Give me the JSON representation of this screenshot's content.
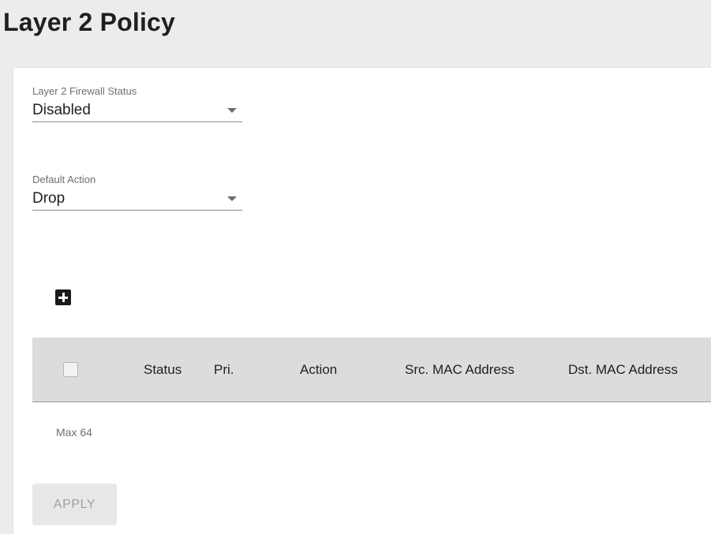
{
  "page": {
    "title": "Layer 2 Policy"
  },
  "firewall_status": {
    "label": "Layer 2 Firewall Status",
    "value": "Disabled"
  },
  "default_action": {
    "label": "Default Action",
    "value": "Drop"
  },
  "toolbar": {
    "add_icon": "plus-box-icon"
  },
  "table": {
    "columns": [
      "Status",
      "Pri.",
      "Action",
      "Src. MAC Address",
      "Dst. MAC Address"
    ],
    "rows": [],
    "max_label": "Max 64"
  },
  "actions": {
    "apply_label": "APPLY"
  },
  "colors": {
    "page_background": "#ececec",
    "card_background": "#ffffff",
    "table_header_background": "#dcdcdc",
    "disabled_button_background": "#e8e8e8",
    "disabled_button_text": "#9e9e9e"
  }
}
